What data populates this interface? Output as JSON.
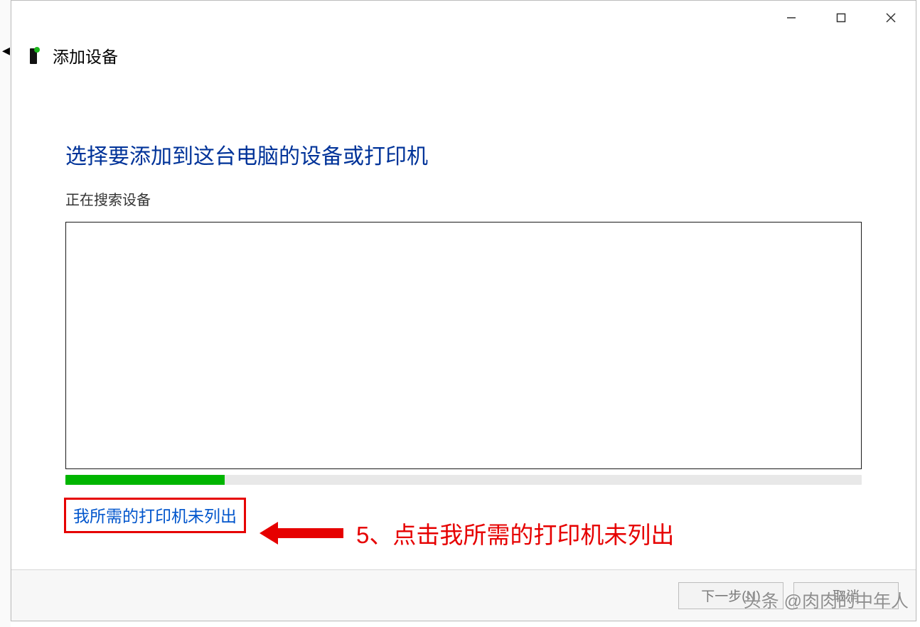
{
  "titlebar": {
    "minimize": "minimize",
    "maximize": "maximize",
    "close": "close"
  },
  "header": {
    "title": "添加设备"
  },
  "main": {
    "heading": "选择要添加到这台电脑的设备或打印机",
    "subheading": "正在搜索设备",
    "progress_percent": 20,
    "link_label": "我所需的打印机未列出"
  },
  "annotation": {
    "text": "5、点击我所需的打印机未列出",
    "color": "#e60000"
  },
  "footer": {
    "next_label": "下一步(N)",
    "cancel_label": "取消"
  },
  "watermark": "头条 @肉肉的中年人"
}
